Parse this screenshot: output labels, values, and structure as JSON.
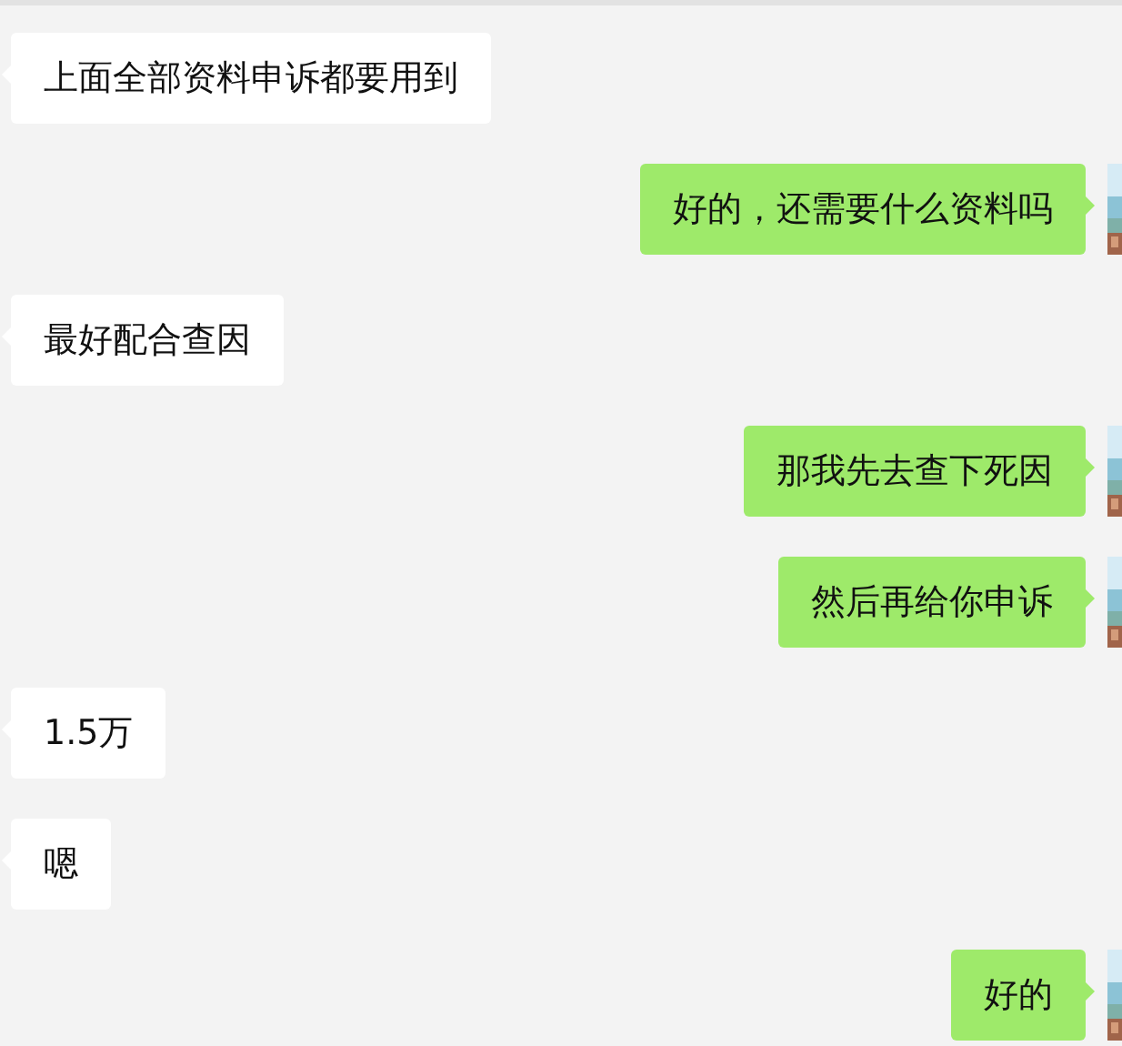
{
  "messages": [
    {
      "kind": "received",
      "text": "上面全部资料申诉都要用到"
    },
    {
      "kind": "sent",
      "text": "好的，还需要什么资料吗"
    },
    {
      "kind": "received",
      "text": "最好配合查因"
    },
    {
      "kind": "sent",
      "text": "那我先去查下死因"
    },
    {
      "kind": "sent",
      "text": "然后再给你申诉"
    },
    {
      "kind": "received",
      "text": "1.5万"
    },
    {
      "kind": "received",
      "text": "嗯"
    },
    {
      "kind": "sent",
      "text": "好的"
    }
  ]
}
